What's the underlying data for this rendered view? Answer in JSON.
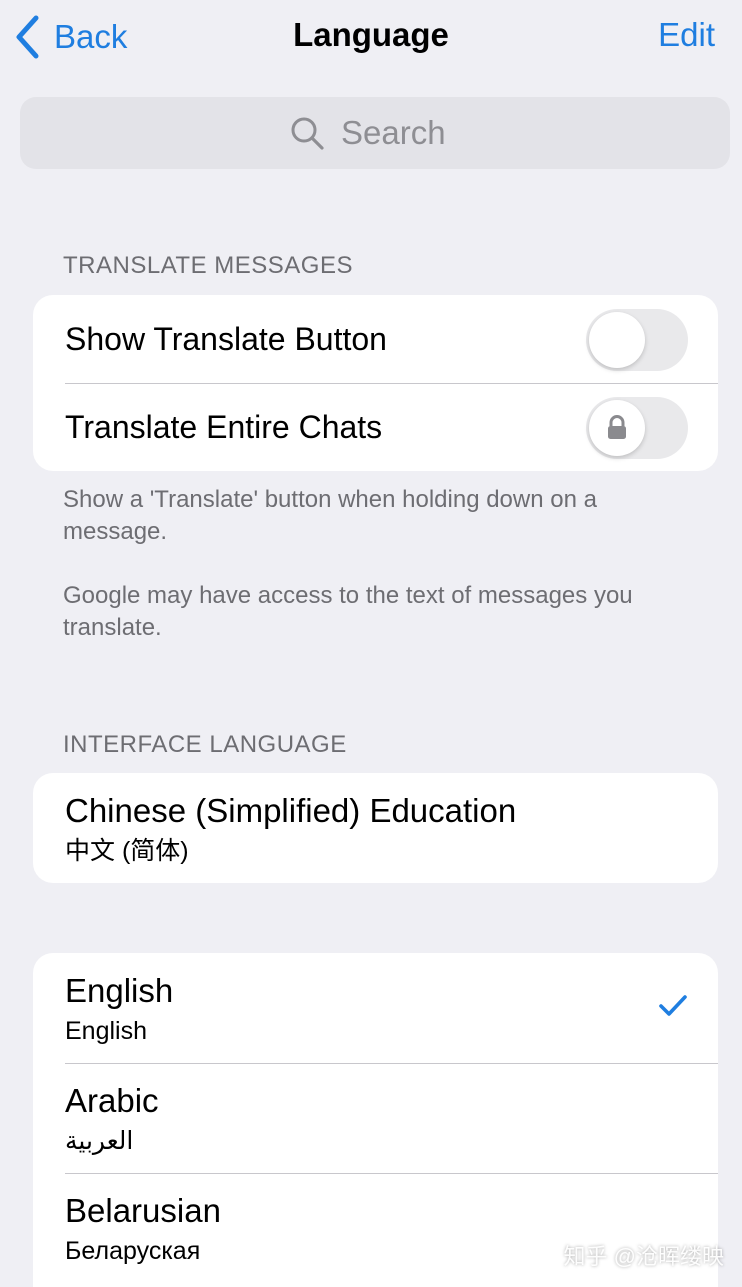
{
  "nav": {
    "back_label": "Back",
    "title": "Language",
    "edit_label": "Edit"
  },
  "search": {
    "placeholder": "Search"
  },
  "translate_section": {
    "header": "TRANSLATE MESSAGES",
    "rows": [
      {
        "label": "Show Translate Button",
        "on": false,
        "locked": false
      },
      {
        "label": "Translate Entire Chats",
        "on": false,
        "locked": true
      }
    ],
    "notes": [
      "Show a 'Translate' button when holding down on a message.",
      "Google may have access to the text of messages you translate."
    ]
  },
  "interface_section": {
    "header": "INTERFACE LANGUAGE",
    "current": {
      "name": "Chinese (Simplified) Education",
      "native": "中文 (简体)"
    }
  },
  "languages": [
    {
      "name": "English",
      "native": "English",
      "selected": true
    },
    {
      "name": "Arabic",
      "native": "العربية",
      "selected": false
    },
    {
      "name": "Belarusian",
      "native": "Беларуская",
      "selected": false
    }
  ],
  "colors": {
    "accent": "#1f7ee0",
    "background": "#efeff4",
    "secondary_text": "#6d6d72"
  },
  "icons": {
    "back": "chevron-left-icon",
    "search": "search-icon",
    "lock": "lock-icon",
    "check": "checkmark-icon"
  },
  "watermark": "知乎 @沧晖缕映"
}
